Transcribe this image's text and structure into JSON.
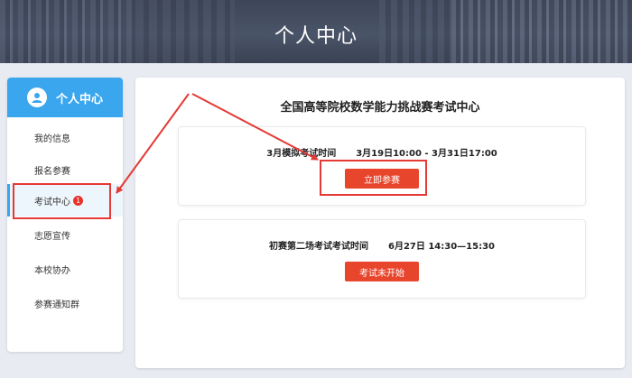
{
  "header": {
    "title": "个人中心"
  },
  "sidebar": {
    "title": "个人中心",
    "items": [
      {
        "label": "我的信息"
      },
      {
        "label": "报名参赛"
      },
      {
        "label": "考试中心",
        "badge": "1",
        "active": true
      },
      {
        "label": "志愿宣传"
      },
      {
        "label": "本校协办"
      },
      {
        "label": "参赛通知群"
      }
    ]
  },
  "main": {
    "title": "全国高等院校数学能力挑战赛考试中心",
    "exams": [
      {
        "name": "3月模拟考试时间",
        "time": "3月19日10:00 - 3月31日17:00",
        "button": "立即参赛"
      },
      {
        "name": "初赛第二场考试考试时间",
        "time": "6月27日 14:30—15:30",
        "button": "考试未开始"
      }
    ]
  },
  "colors": {
    "accent_blue": "#3aa6ee",
    "button_red": "#e8452d",
    "annotation_red": "#e53935",
    "badge_red": "#e8322a"
  }
}
